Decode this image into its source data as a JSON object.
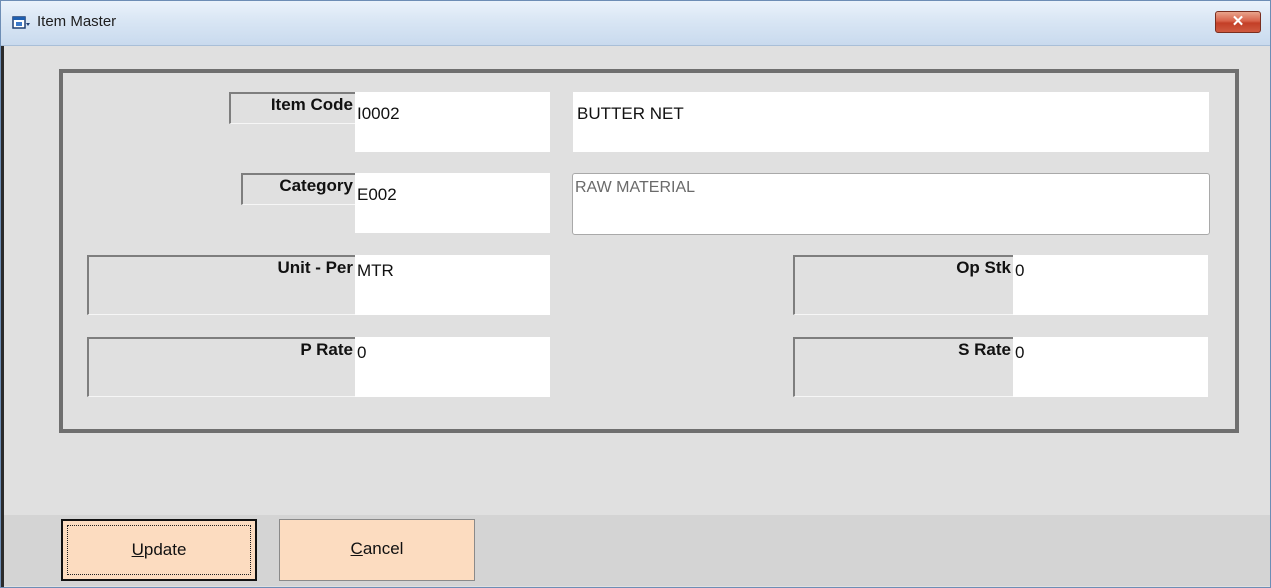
{
  "window": {
    "title": "Item Master",
    "close_label": "✕"
  },
  "form": {
    "item_code": {
      "label": "Item Code",
      "value": "I0002",
      "name_value": "BUTTER NET"
    },
    "category": {
      "label": "Category",
      "value": "E002",
      "name_value": "RAW MATERIAL"
    },
    "unit_per": {
      "label": "Unit - Per",
      "value": "MTR"
    },
    "op_stk": {
      "label": "Op Stk",
      "value": "0"
    },
    "p_rate": {
      "label": "P Rate",
      "value": "0"
    },
    "s_rate": {
      "label": "S Rate",
      "value": "0"
    }
  },
  "buttons": {
    "update": {
      "accel": "U",
      "rest": "pdate"
    },
    "cancel": {
      "accel": "C",
      "rest": "ancel"
    }
  },
  "colors": {
    "button_bg": "#fcdcc0",
    "close_bg": "#c33f27"
  },
  "icons": {
    "app": "window-app-icon",
    "close": "close-icon"
  }
}
